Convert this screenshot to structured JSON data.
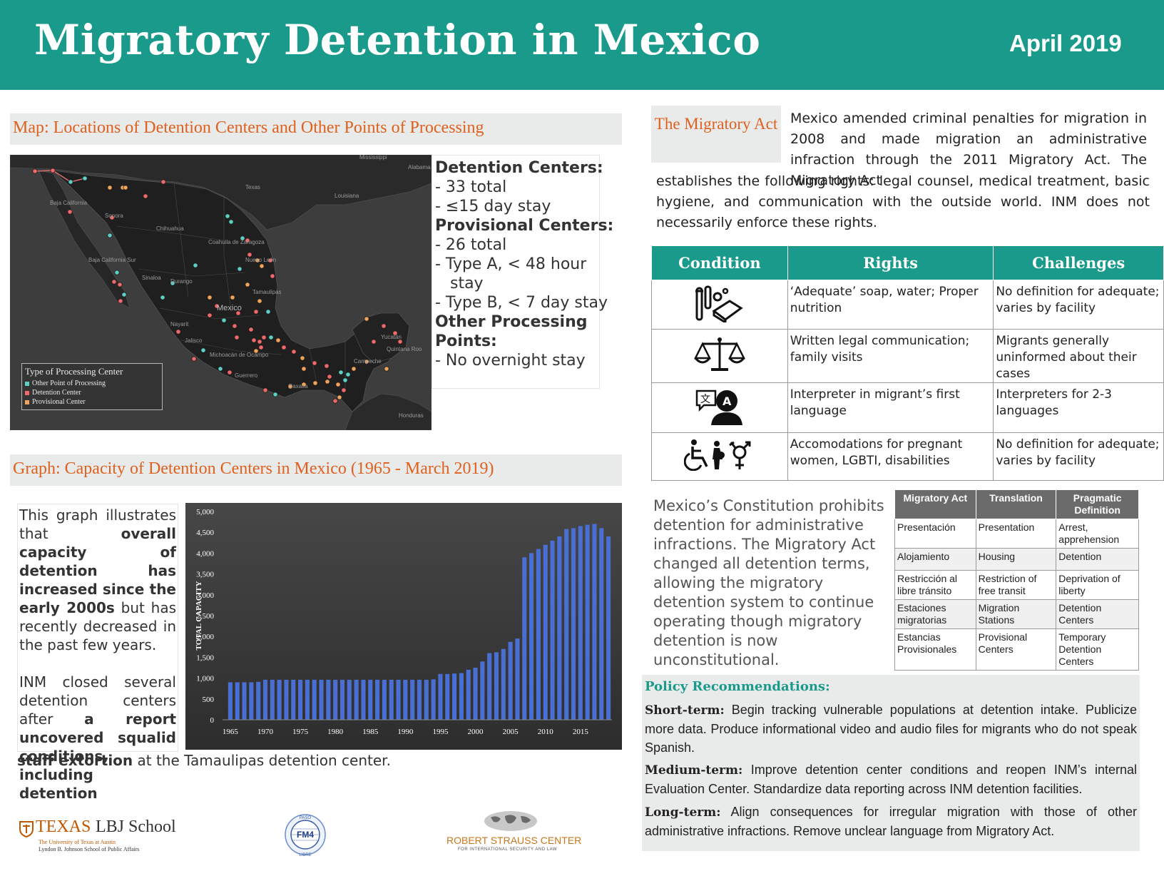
{
  "header": {
    "title": "Migratory Detention in Mexico",
    "date": "April 2019"
  },
  "map_section": {
    "heading": "Map: Locations of Detention Centers and Other Points of Processing",
    "legend": {
      "title": "Type of Processing Center",
      "items": [
        {
          "label": "Other Point of Processing",
          "color": "#5ecfc4"
        },
        {
          "label": "Detention Center",
          "color": "#f0686a"
        },
        {
          "label": "Provisional Center",
          "color": "#f2a35a"
        }
      ]
    },
    "place_labels": [
      "Mississippi",
      "Alabama",
      "Baja California",
      "Texas",
      "Louisiana",
      "Sonora",
      "Chihuahua",
      "Coahuila de Zaragoza",
      "Baja California Sur",
      "Nuevo León",
      "Sinaloa",
      "Durango",
      "Tamaulipas",
      "Mexico",
      "Nayarit",
      "Jalisco",
      "Michoacán de Ocampo",
      "Guerrero",
      "Oaxaca",
      "Campeche",
      "Yucatán",
      "Quintana Roo",
      "Honduras"
    ],
    "summary": [
      {
        "type": "heading",
        "text": "Detention Centers:"
      },
      {
        "type": "item",
        "text": "- 33 total"
      },
      {
        "type": "item",
        "text": "- ≤15 day stay"
      },
      {
        "type": "heading",
        "text": "Provisional Centers:"
      },
      {
        "type": "item",
        "text": "- 26 total"
      },
      {
        "type": "item",
        "text": "- Type A,  < 48 hour"
      },
      {
        "type": "item",
        "text": "   stay"
      },
      {
        "type": "item",
        "text": "- Type B, < 7 day stay"
      },
      {
        "type": "heading",
        "text": "Other Processing"
      },
      {
        "type": "heading",
        "text": "Points:"
      },
      {
        "type": "item",
        "text": "- No overnight stay"
      }
    ]
  },
  "graph_section": {
    "heading": "Graph: Capacity of Detention Centers in Mexico (1965 - March 2019)",
    "text_p1_a": "This graph illustrates that ",
    "text_p1_b": "overall capacity of detention has increased since the early 2000s",
    "text_p1_c": " but has recently decreased in the past few years.",
    "text_p2_a": "INM closed several detention centers after ",
    "text_p2_b": "a report uncovered squalid conditions, including detention",
    "tail_b": "staff extortion",
    "tail_c": " at the Tamaulipas detention center."
  },
  "chart_data": {
    "type": "bar",
    "title": "",
    "xlabel": "",
    "ylabel": "TOTAL CAPACITY",
    "ylim": [
      0,
      5000
    ],
    "yticks": [
      "0",
      "500",
      "1,000",
      "1,500",
      "2,000",
      "2,500",
      "3,000",
      "3,500",
      "4,000",
      "4,500",
      "5,000"
    ],
    "xticks": [
      "1965",
      "1970",
      "1975",
      "1980",
      "1985",
      "1990",
      "1995",
      "2000",
      "2005",
      "2010",
      "2015"
    ],
    "bar_color": "#4a6fd4",
    "x": [
      1965,
      1966,
      1967,
      1968,
      1969,
      1970,
      1971,
      1972,
      1973,
      1974,
      1975,
      1976,
      1977,
      1978,
      1979,
      1980,
      1981,
      1982,
      1983,
      1984,
      1985,
      1986,
      1987,
      1988,
      1989,
      1990,
      1991,
      1992,
      1993,
      1994,
      1995,
      1996,
      1997,
      1998,
      1999,
      2000,
      2001,
      2002,
      2003,
      2004,
      2005,
      2006,
      2007,
      2008,
      2009,
      2010,
      2011,
      2012,
      2013,
      2014,
      2015,
      2016,
      2017,
      2018,
      2019
    ],
    "values": [
      900,
      900,
      900,
      900,
      910,
      960,
      960,
      960,
      960,
      960,
      960,
      960,
      960,
      960,
      960,
      960,
      960,
      960,
      960,
      960,
      960,
      960,
      960,
      960,
      960,
      960,
      960,
      960,
      960,
      970,
      1100,
      1100,
      1110,
      1120,
      1200,
      1250,
      1400,
      1600,
      1620,
      1700,
      1870,
      1950,
      3900,
      4000,
      4100,
      4200,
      4300,
      4400,
      4580,
      4600,
      4650,
      4680,
      4700,
      4600,
      4400
    ]
  },
  "migratory_act": {
    "box_label": "The Migratory Act",
    "paragraph_indented": "Mexico amended criminal penalties for migration in 2008 and made migration an administrative infraction through the 2011 Migratory Act.  The Migratory Act",
    "paragraph_full": "establishes the following rights: legal counsel, medical treatment, basic hygiene,   and communication with the outside world. INM does not necessarily enforce these rights."
  },
  "rights_table": {
    "headers": [
      "Condition",
      "Rights",
      "Challenges"
    ],
    "rows": [
      {
        "icon": "hygiene-icon",
        "rights": "‘Adequate’ soap, water; Proper nutrition",
        "challenges": "No definition for adequate; varies by facility"
      },
      {
        "icon": "scales-icon",
        "rights": "Written legal communication; family visits",
        "challenges": "Migrants generally uninformed about their cases"
      },
      {
        "icon": "interpreter-icon",
        "rights": "Interpreter in migrant’s first language",
        "challenges": "Interpreters for 2-3 languages"
      },
      {
        "icon": "accessibility-icon",
        "rights": "Accomodations for pregnant women, LGBTI, disabilities",
        "challenges": "No definition for adequate; varies by facility"
      }
    ]
  },
  "constitution_text": "Mexico’s Constitution prohibits detention for administrative infractions. The Migratory Act changed all detention terms, allowing the migratory detention system to continue operating though migratory detention is now unconstitutional.",
  "translation_table": {
    "headers": [
      "Migratory Act",
      "Translation",
      "Pragmatic Definition"
    ],
    "rows": [
      [
        "Presentación",
        "Presentation",
        "Arrest, apprehension"
      ],
      [
        "Alojamiento",
        "Housing",
        "Detention"
      ],
      [
        "Restricción al libre tránsito",
        "Restriction of free transit",
        "Deprivation of liberty"
      ],
      [
        "Estaciones migratorias",
        "Migration Stations",
        "Detention Centers"
      ],
      [
        "Estancias Provisionales",
        "Provisional Centers",
        "Temporary Detention Centers"
      ]
    ]
  },
  "policy": {
    "heading": "Policy Recommendations:",
    "items": [
      {
        "term": "Short-term:",
        "text": " Begin tracking vulnerable populations at detention intake. Publicize more data. Produce informational video and audio files for migrants who do not speak Spanish."
      },
      {
        "term": "Medium-term:",
        "text": " Improve detention center conditions and reopen INM’s internal Evaluation Center. Standardize data reporting across INM detention facilities."
      },
      {
        "term": "Long-term:",
        "text": " Align consequences for irregular migration with those of other administrative infractions. Remove unclear language from Migratory Act."
      }
    ]
  },
  "logos": {
    "texas_a": "TEXAS",
    "texas_b": "LBJ School",
    "texas_sub1": "The University of Texas at Austin",
    "texas_sub2": "Lyndon B. Johnson School of Public Affairs",
    "fm4_top": "PASO",
    "fm4_mid": "FM4",
    "fm4_bottom": "LIBRE",
    "strauss_a": "ROBERT STRAUSS CENTER",
    "strauss_b": "FOR INTERNATIONAL SECURITY AND LAW"
  }
}
